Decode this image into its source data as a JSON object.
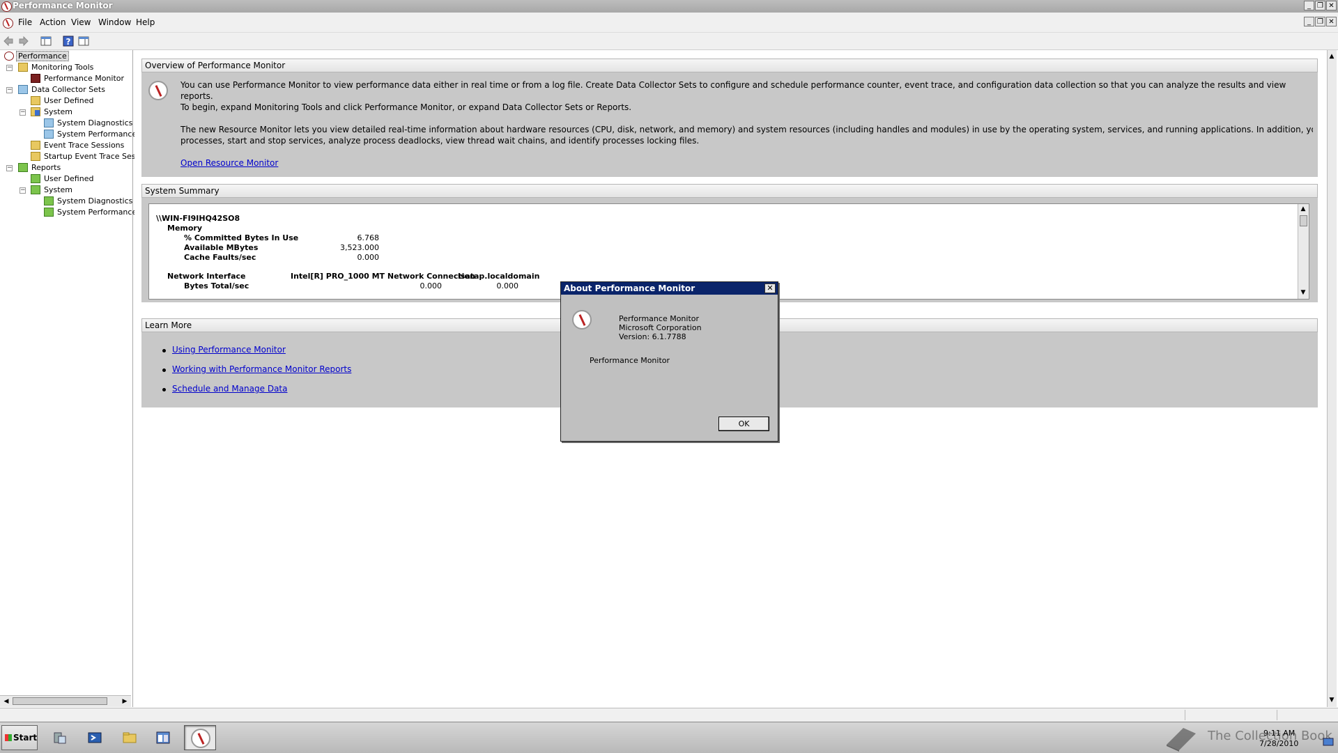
{
  "window": {
    "title": "Performance Monitor",
    "buttons": [
      "_",
      "❐",
      "✕"
    ]
  },
  "menu": [
    "File",
    "Action",
    "View",
    "Window",
    "Help"
  ],
  "tree": {
    "root": "Performance",
    "monitoring_tools": "Monitoring Tools",
    "performance_monitor": "Performance Monitor",
    "data_collector_sets": "Data Collector Sets",
    "dcs_user_defined": "User Defined",
    "dcs_system": "System",
    "dcs_system_diagnostics": "System Diagnostics",
    "dcs_system_performance": "System Performance",
    "event_trace_sessions": "Event Trace Sessions",
    "startup_event_trace": "Startup Event Trace Sess",
    "reports": "Reports",
    "rep_user_defined": "User Defined",
    "rep_system": "System",
    "rep_system_diagnostics": "System Diagnostics",
    "rep_system_performance": "System Performance"
  },
  "overview": {
    "header": "Overview of Performance Monitor",
    "p1": "You can use Performance Monitor to view performance data either in real time or from a log file. Create Data Collector Sets to configure and schedule performance counter, event trace, and configuration data collection so that you can analyze the results and view reports.",
    "p2": "To begin, expand Monitoring Tools and click Performance Monitor, or expand Data Collector Sets or Reports.",
    "p3a": "The new Resource Monitor lets you view detailed real-time information about hardware resources (CPU, disk, network, and memory) and system resources (including handles and modules) in use by the operating system, services, and running applications. In addition, you can use Resource Monitor to stop",
    "p3b": "processes, start and stop services, analyze process deadlocks, view thread wait chains, and identify processes locking files.",
    "link": "Open Resource Monitor"
  },
  "summary": {
    "header": "System Summary",
    "machine": "\\\\WIN-FI9IHQ42SO8",
    "memory": "Memory",
    "committed_label": "% Committed Bytes In Use",
    "committed_value": "6.768",
    "available_label": "Available MBytes",
    "available_value": "3,523.000",
    "faults_label": "Cache Faults/sec",
    "faults_value": "0.000",
    "net_label": "Network Interface",
    "net_adapter": "Intel[R] PRO_1000 MT Network Connection",
    "net_isatap": "isatap.localdomain",
    "bytes_label": "Bytes Total/sec",
    "bytes_value1": "0.000",
    "bytes_value2": "0.000"
  },
  "learn_more": {
    "header": "Learn More",
    "links": [
      "Using Performance Monitor",
      "Working with Performance Monitor Reports",
      "Schedule and Manage Data"
    ]
  },
  "dialog": {
    "title": "About Performance Monitor",
    "close": "✕",
    "product": "Performance Monitor",
    "company": "Microsoft Corporation",
    "version": "Version: 6.1.7788",
    "description": "Performance Monitor",
    "ok": "OK"
  },
  "taskbar": {
    "start": "Start",
    "time": "9:11 AM",
    "date": "7/28/2010",
    "watermark": "The Collection Book"
  },
  "scroll": {
    "left": "◀",
    "right": "▶",
    "up": "▲",
    "down": "▼"
  }
}
